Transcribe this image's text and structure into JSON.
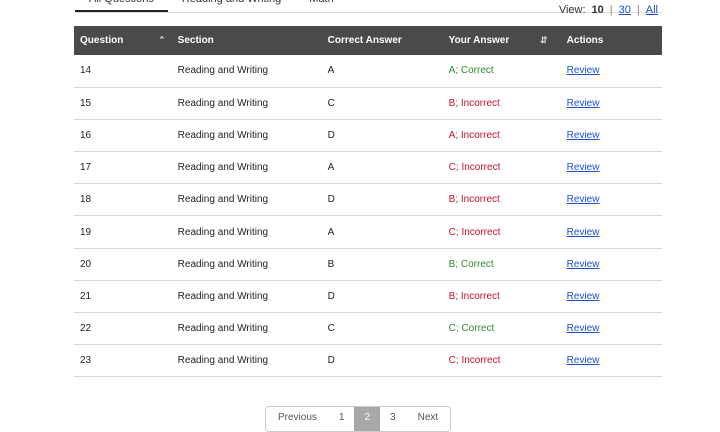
{
  "tabs": [
    {
      "label": "All Questions"
    },
    {
      "label": "Reading and Writing"
    },
    {
      "label": "Math"
    }
  ],
  "view": {
    "prefix": "View:",
    "current": "10",
    "opt2": "30",
    "opt3": "All",
    "sep": "|"
  },
  "table": {
    "headers": {
      "question": "Question",
      "section": "Section",
      "correct": "Correct Answer",
      "yours": "Your Answer",
      "actions": "Actions"
    },
    "rows": [
      {
        "q": "14",
        "section": "Reading and Writing",
        "correct": "A",
        "yours": "A; Correct",
        "status": "correct",
        "action": "Review"
      },
      {
        "q": "15",
        "section": "Reading and Writing",
        "correct": "C",
        "yours": "B; Incorrect",
        "status": "incorrect",
        "action": "Review"
      },
      {
        "q": "16",
        "section": "Reading and Writing",
        "correct": "D",
        "yours": "A; Incorrect",
        "status": "incorrect",
        "action": "Review"
      },
      {
        "q": "17",
        "section": "Reading and Writing",
        "correct": "A",
        "yours": "C; Incorrect",
        "status": "incorrect",
        "action": "Review"
      },
      {
        "q": "18",
        "section": "Reading and Writing",
        "correct": "D",
        "yours": "B; Incorrect",
        "status": "incorrect",
        "action": "Review"
      },
      {
        "q": "19",
        "section": "Reading and Writing",
        "correct": "A",
        "yours": "C; Incorrect",
        "status": "incorrect",
        "action": "Review"
      },
      {
        "q": "20",
        "section": "Reading and Writing",
        "correct": "B",
        "yours": "B; Correct",
        "status": "correct",
        "action": "Review"
      },
      {
        "q": "21",
        "section": "Reading and Writing",
        "correct": "D",
        "yours": "B; Incorrect",
        "status": "incorrect",
        "action": "Review"
      },
      {
        "q": "22",
        "section": "Reading and Writing",
        "correct": "C",
        "yours": "C; Correct",
        "status": "correct",
        "action": "Review"
      },
      {
        "q": "23",
        "section": "Reading and Writing",
        "correct": "D",
        "yours": "C; Incorrect",
        "status": "incorrect",
        "action": "Review"
      }
    ]
  },
  "pager": {
    "prev": "Previous",
    "pages": [
      "1",
      "2",
      "3"
    ],
    "next": "Next"
  },
  "colors": {
    "header_bg": "#4a4a4a",
    "correct": "#2e8b2e",
    "incorrect": "#c8102e",
    "link": "#1a4fd6"
  },
  "icons": {
    "question_sort": "chevron-up-icon",
    "answer_sort": "sort-updown-icon"
  }
}
